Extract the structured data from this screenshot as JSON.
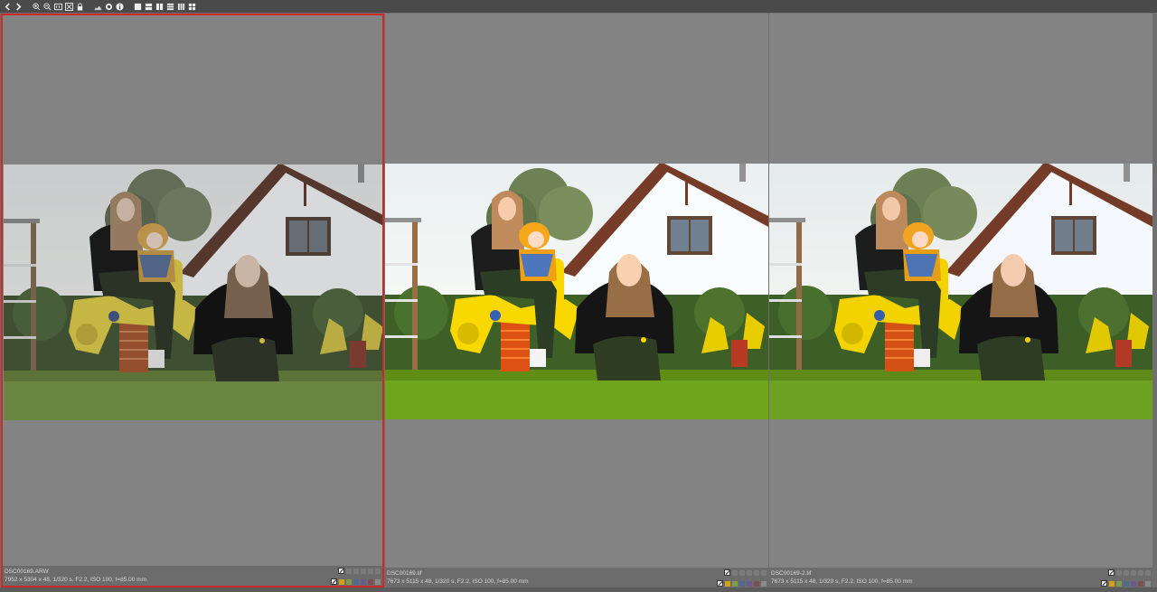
{
  "toolbar": {
    "buttons": [
      {
        "name": "prev-icon"
      },
      {
        "name": "next-icon"
      },
      {
        "name": "zoom-in-icon"
      },
      {
        "name": "zoom-out-icon"
      },
      {
        "name": "zoom-100-icon"
      },
      {
        "name": "fit-screen-icon"
      },
      {
        "name": "lock-icon"
      },
      {
        "name": "histogram-icon"
      },
      {
        "name": "focus-point-icon"
      },
      {
        "name": "info-icon"
      },
      {
        "name": "layout-1-icon"
      },
      {
        "name": "layout-2-rows-icon"
      },
      {
        "name": "layout-2-cols-icon"
      },
      {
        "name": "layout-3-rows-icon"
      },
      {
        "name": "layout-3-cols-icon"
      },
      {
        "name": "layout-4-icon"
      }
    ]
  },
  "panes": [
    {
      "filename": "DSC00169.ARW",
      "meta": "7952 x 5304 x 48, 1/320 s, F2.2, ISO 100, f=85.00 mm",
      "active": true,
      "tone": "raw"
    },
    {
      "filename": "DSC00169.tif",
      "meta": "7673 x 5115 x 48, 1/320 s, F2.2, ISO 100, f=85.00 mm",
      "active": false,
      "tone": "processed"
    },
    {
      "filename": "DSC00169-2.tif",
      "meta": "7673 x 5115 x 48, 1/320 s, F2.2, ISO 100, f=85.00 mm",
      "active": false,
      "tone": "processed"
    }
  ],
  "colors": {
    "active_border": "#cc2a2a",
    "label_chips": [
      "#d4a017",
      "#7f9a48",
      "#4f6a8e",
      "#6b5a8e",
      "#7b5050",
      "#8a8a8a"
    ]
  }
}
